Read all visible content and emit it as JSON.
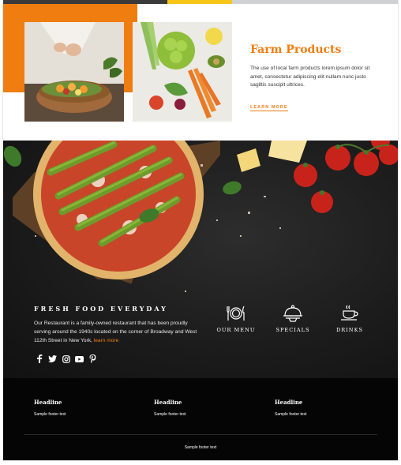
{
  "colors": {
    "accent": "#f07d10",
    "yellow": "#f5c518",
    "dark": "#1c1c1c",
    "footer": "#050505"
  },
  "farm": {
    "title": "Farm Products",
    "description": "The use of local farm products lorem ipsum dolor sit amet, consectetur adipiscing elit nullam nunc justo sagittis suscipit ultrices.",
    "link_label": "LEARN MORE"
  },
  "about": {
    "tagline": "FRESH FOOD EVERYDAY",
    "text": "Our Restaurant is a family-owned restaurant that has been proudly serving around the 1940s located on the corner of Broadway and West 112th Street in New York,",
    "link_label": "learn more"
  },
  "socials": [
    "facebook-icon",
    "twitter-icon",
    "instagram-icon",
    "youtube-icon",
    "pinterest-icon"
  ],
  "features": [
    {
      "icon": "plate-cutlery-icon",
      "label": "OUR MENU"
    },
    {
      "icon": "cloche-icon",
      "label": "SPECIALS"
    },
    {
      "icon": "cup-icon",
      "label": "DRINKS"
    }
  ],
  "footer": {
    "columns": [
      {
        "headline": "Headline",
        "text": "Sample footer text"
      },
      {
        "headline": "Headline",
        "text": "Sample footer text"
      },
      {
        "headline": "Headline",
        "text": "Sample footer text"
      }
    ],
    "bottom_text": "Sample footer text"
  }
}
